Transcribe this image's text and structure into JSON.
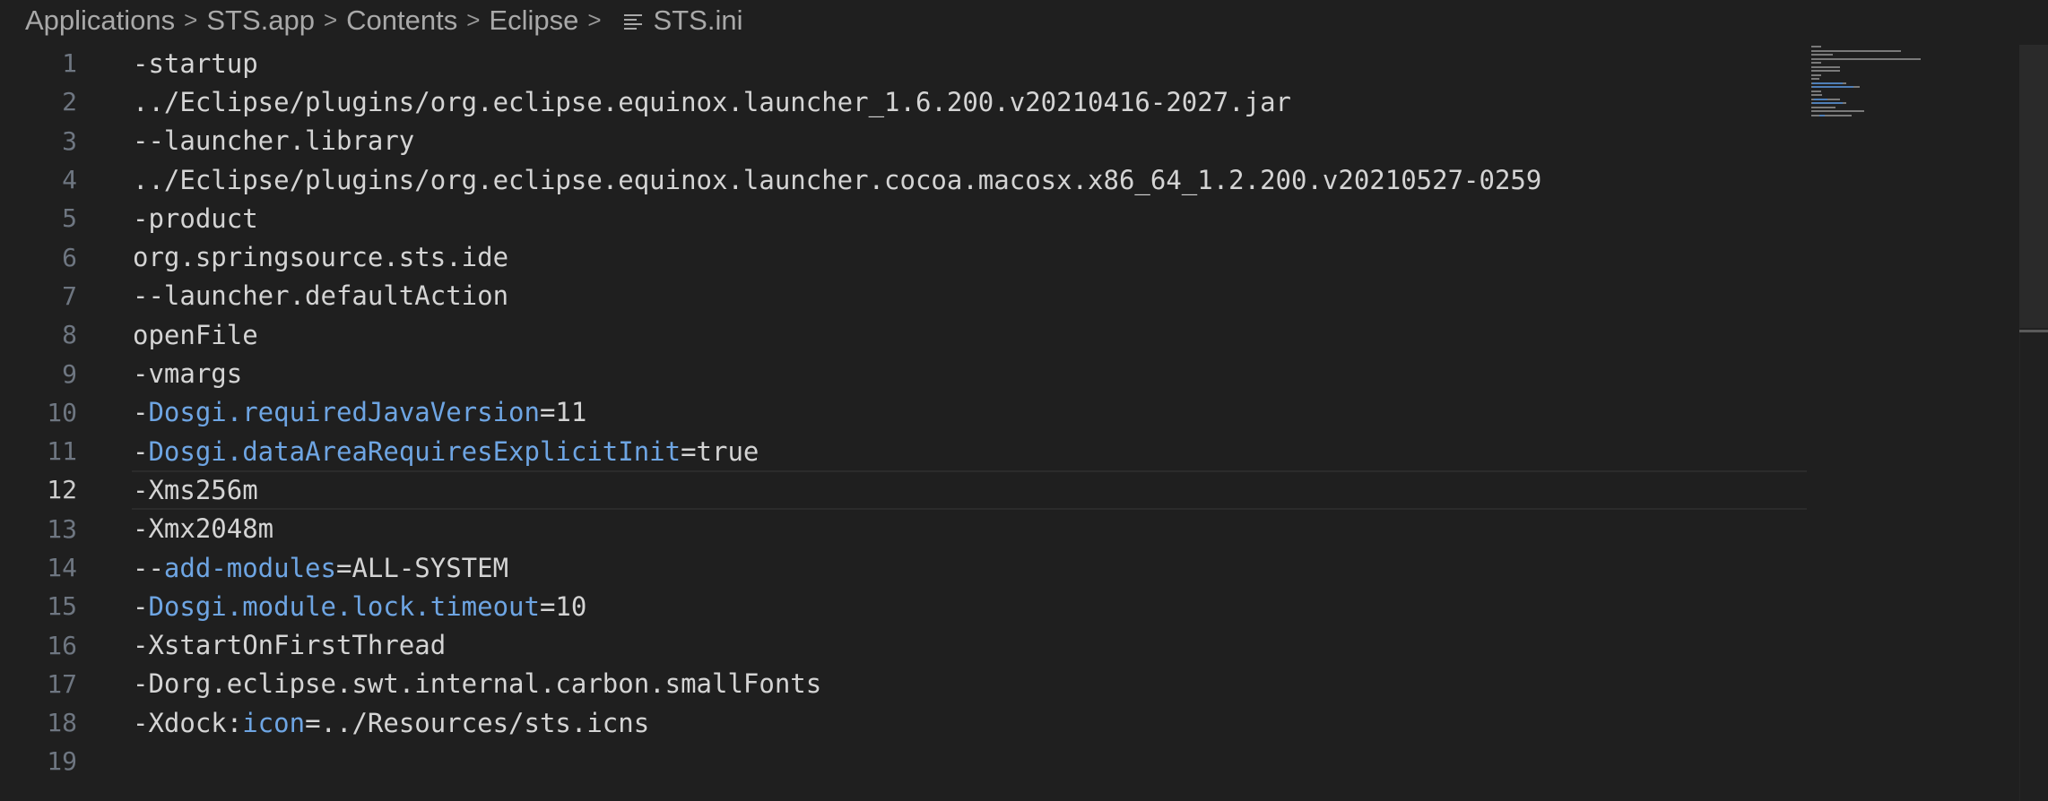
{
  "breadcrumb": {
    "items": [
      "Applications",
      "STS.app",
      "Contents",
      "Eclipse"
    ],
    "file": "STS.ini",
    "separator": ">"
  },
  "editor": {
    "current_line": 12,
    "lines": [
      {
        "num": "1",
        "segments": [
          {
            "t": "-startup"
          }
        ]
      },
      {
        "num": "2",
        "segments": [
          {
            "t": "../Eclipse/plugins/org.eclipse.equinox.launcher_1.6.200.v20210416-2027.jar"
          }
        ]
      },
      {
        "num": "3",
        "segments": [
          {
            "t": "--launcher.library"
          }
        ]
      },
      {
        "num": "4",
        "segments": [
          {
            "t": "../Eclipse/plugins/org.eclipse.equinox.launcher.cocoa.macosx.x86_64_1.2.200.v20210527-0259"
          }
        ]
      },
      {
        "num": "5",
        "segments": [
          {
            "t": "-product"
          }
        ]
      },
      {
        "num": "6",
        "segments": [
          {
            "t": "org.springsource.sts.ide"
          }
        ]
      },
      {
        "num": "7",
        "segments": [
          {
            "t": "--launcher.defaultAction"
          }
        ]
      },
      {
        "num": "8",
        "segments": [
          {
            "t": "openFile"
          }
        ]
      },
      {
        "num": "9",
        "segments": [
          {
            "t": "-vmargs"
          }
        ]
      },
      {
        "num": "10",
        "segments": [
          {
            "t": "-"
          },
          {
            "t": "Dosgi.requiredJavaVersion",
            "k": true
          },
          {
            "t": "=11"
          }
        ]
      },
      {
        "num": "11",
        "segments": [
          {
            "t": "-"
          },
          {
            "t": "Dosgi.dataAreaRequiresExplicitInit",
            "k": true
          },
          {
            "t": "=true"
          }
        ]
      },
      {
        "num": "12",
        "segments": [
          {
            "t": "-Xms256m"
          }
        ]
      },
      {
        "num": "13",
        "segments": [
          {
            "t": "-Xmx2048m"
          }
        ]
      },
      {
        "num": "14",
        "segments": [
          {
            "t": "--"
          },
          {
            "t": "add-modules",
            "k": true
          },
          {
            "t": "=ALL-SYSTEM"
          }
        ]
      },
      {
        "num": "15",
        "segments": [
          {
            "t": "-"
          },
          {
            "t": "Dosgi.module.lock.timeout",
            "k": true
          },
          {
            "t": "=10"
          }
        ]
      },
      {
        "num": "16",
        "segments": [
          {
            "t": "-XstartOnFirstThread"
          }
        ]
      },
      {
        "num": "17",
        "segments": [
          {
            "t": "-Dorg.eclipse.swt.internal.carbon.smallFonts"
          }
        ]
      },
      {
        "num": "18",
        "segments": [
          {
            "t": "-Xdock:"
          },
          {
            "t": "icon",
            "k": true
          },
          {
            "t": "=../Resources/sts.icns"
          }
        ]
      },
      {
        "num": "19",
        "segments": []
      }
    ]
  },
  "colors": {
    "background": "#1f1f1f",
    "text": "#d4d4d4",
    "keyword": "#6ea5e3",
    "line_number": "#6e7681",
    "breadcrumb": "#a9a9a9"
  }
}
